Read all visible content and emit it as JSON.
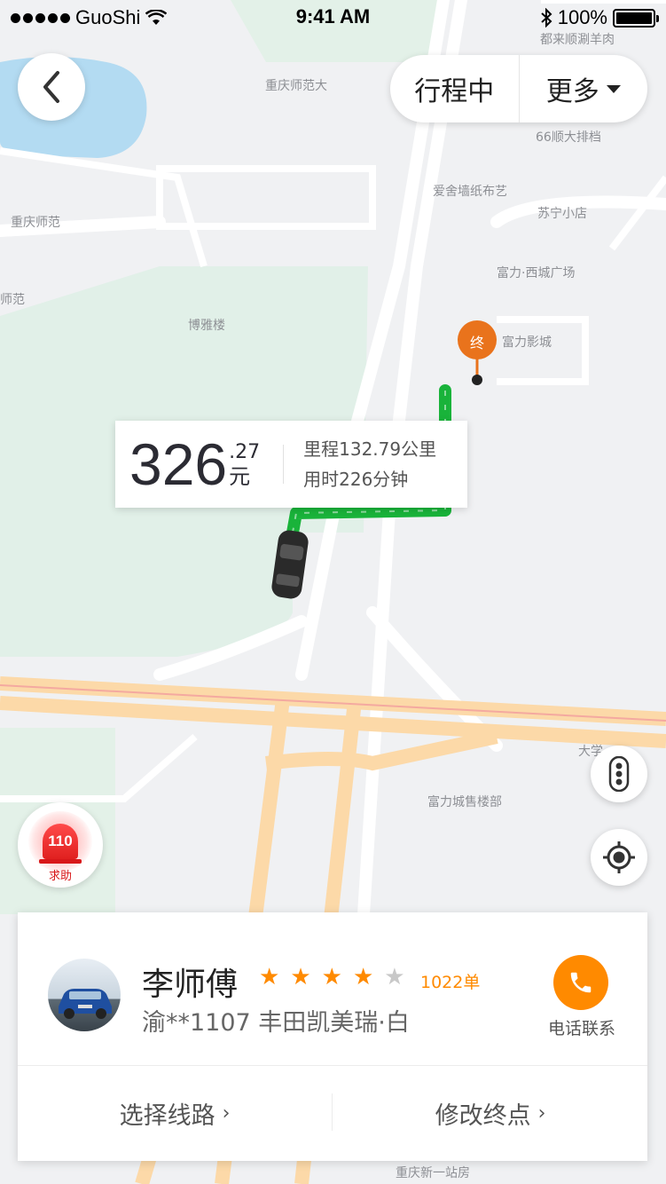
{
  "status_bar": {
    "carrier": "GuoShi",
    "time": "9:41 AM",
    "battery": "100%",
    "battery_level": 1.0
  },
  "top": {
    "status_label": "行程中",
    "more_label": "更多"
  },
  "map": {
    "pois": [
      "都来顺涮羊肉",
      "重庆师范大",
      "66顺大排档",
      "爱舍墙纸布艺",
      "苏宁小店",
      "重庆师范",
      "富力·西城广场",
      "师范",
      "博雅楼",
      "富力影城",
      "大学",
      "富力城售楼部",
      "重庆新一站房"
    ],
    "destination_marker": "终"
  },
  "fare": {
    "integer": "326",
    "decimal": ".27",
    "unit": "元",
    "distance": "里程132.79公里",
    "duration": "用时226分钟"
  },
  "sos": {
    "number": "110",
    "label": "求助"
  },
  "driver": {
    "name": "李师傅",
    "rating_stars": 4,
    "rating_max": 5,
    "orders": "1022单",
    "plate_and_car": "渝**1107  丰田凯美瑞·白",
    "phone_label": "电话联系"
  },
  "actions": {
    "route": "选择线路",
    "destination": "修改终点"
  },
  "colors": {
    "accent": "#ff8a00",
    "route": "#19b33a",
    "sos": "#e0201f"
  }
}
